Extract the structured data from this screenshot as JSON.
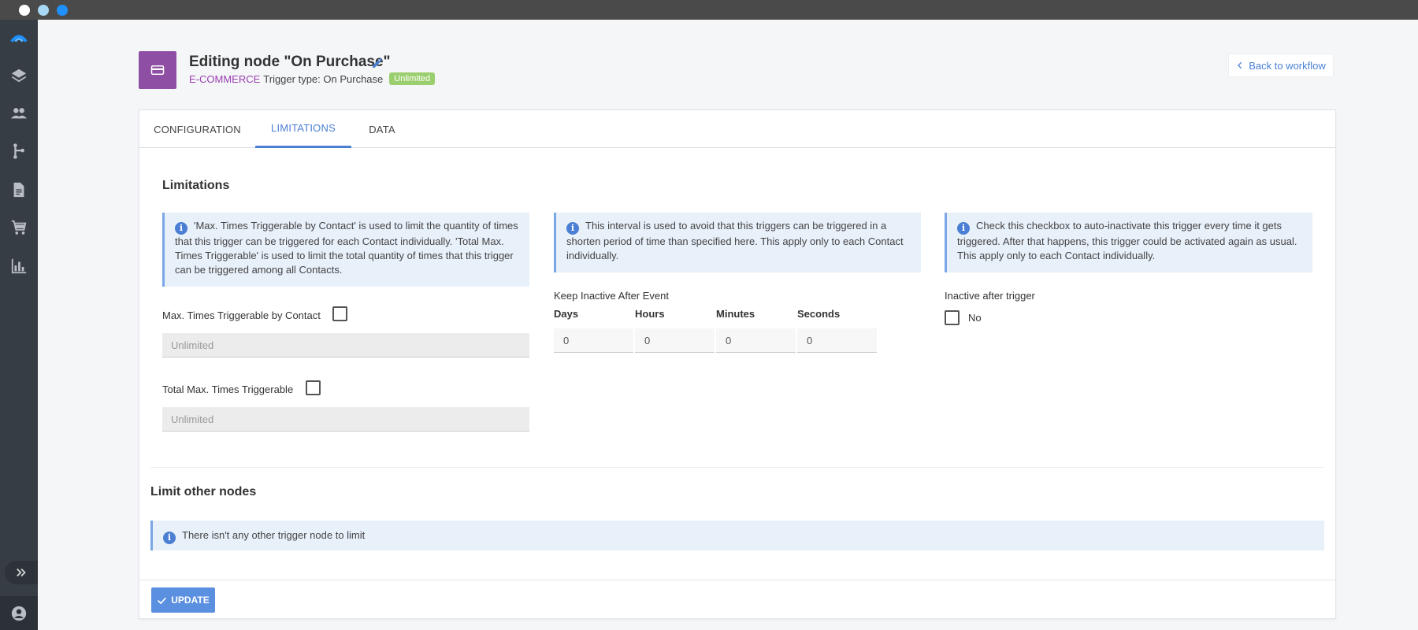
{
  "header": {
    "title": "Editing node \"On Purchase\"",
    "category": "E-COMMERCE",
    "trigger_type": "Trigger type: On Purchase",
    "badge": "Unlimited",
    "back_link": "Back to workflow"
  },
  "tabs": [
    {
      "label": "CONFIGURATION"
    },
    {
      "label": "LIMITATIONS",
      "active": true
    },
    {
      "label": "DATA"
    }
  ],
  "limitations": {
    "title": "Limitations",
    "info_left": "'Max. Times Triggerable by Contact' is used to limit the quantity of times that this trigger can be triggered for each Contact individually. 'Total Max. Times Triggerable' is used to limit the total quantity of times that this trigger can be triggered among all Contacts.",
    "info_middle": "This interval is used to avoid that this triggers can be triggered in a shorten period of time than specified here. This apply only to each Contact individually.",
    "info_right": "Check this checkbox to auto-inactivate this trigger every time it gets triggered. After that happens, this trigger could be activated again as usual. This apply only to each Contact individually.",
    "max_by_contact_label": "Max. Times Triggerable by Contact",
    "max_by_contact_placeholder": "Unlimited",
    "total_max_label": "Total Max. Times Triggerable",
    "total_max_placeholder": "Unlimited",
    "keep_inactive_label": "Keep Inactive After Event",
    "interval": {
      "days_label": "Days",
      "days_value": "0",
      "hours_label": "Hours",
      "hours_value": "0",
      "minutes_label": "Minutes",
      "minutes_value": "0",
      "seconds_label": "Seconds",
      "seconds_value": "0"
    },
    "inactive_after_trigger_label": "Inactive after trigger",
    "inactive_after_trigger_value": "No"
  },
  "limit_other_nodes": {
    "title": "Limit other nodes",
    "info": "There isn't any other trigger node to limit"
  },
  "footer": {
    "update_label": "UPDATE"
  },
  "colors": {
    "accent": "#4a7fd4",
    "category": "#9b3fb0",
    "node_badge": "#8e4ea3",
    "badge": "#9bce6e",
    "sidebar": "#363d44"
  },
  "icons": {
    "sidebar": [
      "logo-icon",
      "layers-icon",
      "contacts-icon",
      "workflow-icon",
      "document-icon",
      "cart-icon",
      "chart-icon",
      "expand-icon",
      "user-icon"
    ]
  }
}
